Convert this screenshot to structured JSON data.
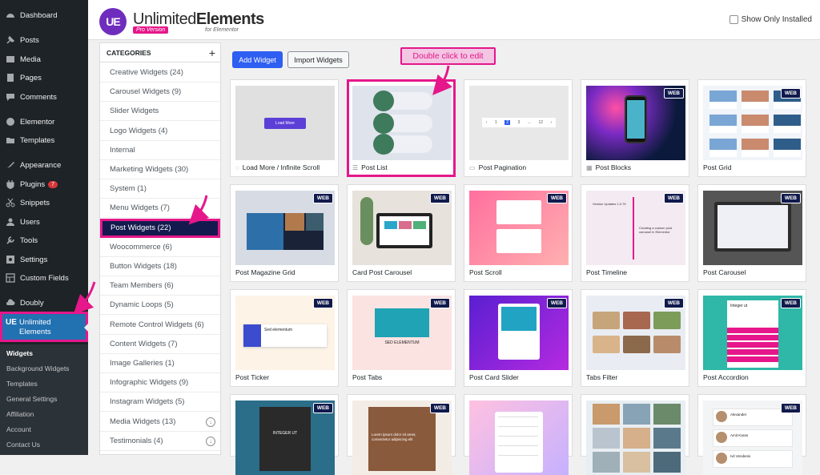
{
  "wp_menu": [
    {
      "label": "Dashboard",
      "icon": "dashboard-icon"
    },
    {
      "label": "Posts",
      "icon": "pin-icon"
    },
    {
      "label": "Media",
      "icon": "media-icon"
    },
    {
      "label": "Pages",
      "icon": "pages-icon"
    },
    {
      "label": "Comments",
      "icon": "comment-icon"
    },
    {
      "label": "Elementor",
      "icon": "elementor-icon"
    },
    {
      "label": "Templates",
      "icon": "folder-icon"
    },
    {
      "label": "Appearance",
      "icon": "brush-icon"
    },
    {
      "label": "Plugins",
      "icon": "plug-icon",
      "badge": "7"
    },
    {
      "label": "Snippets",
      "icon": "scissors-icon"
    },
    {
      "label": "Users",
      "icon": "user-icon"
    },
    {
      "label": "Tools",
      "icon": "wrench-icon"
    },
    {
      "label": "Settings",
      "icon": "settings-icon"
    },
    {
      "label": "Custom Fields",
      "icon": "fields-icon"
    },
    {
      "label": "Doubly",
      "icon": "cloud-icon"
    }
  ],
  "ue_menu_item": {
    "label_line1": "Unlimited",
    "label_line2": "Elements",
    "icon_text": "UE"
  },
  "submenu": [
    "Widgets",
    "Background Widgets",
    "Templates",
    "General Settings",
    "Affiliation",
    "Account",
    "Contact Us"
  ],
  "header": {
    "logo_initials": "UE",
    "logo_title_light": "Unlimited",
    "logo_title_bold": "Elements",
    "logo_badge": "Pro Version",
    "logo_sub": "for Elementor",
    "show_only_installed": "Show Only Installed"
  },
  "categories": {
    "title": "CATEGORIES",
    "add_symbol": "+",
    "items": [
      "Creative Widgets (24)",
      "Carousel Widgets (9)",
      "Slider Widgets",
      "Logo Widgets (4)",
      "Internal",
      "Marketing Widgets (30)",
      "System (1)",
      "Menu Widgets (7)",
      "Post Widgets (22)",
      "Woocommerce (6)",
      "Button Widgets (18)",
      "Team Members (6)",
      "Dynamic Loops (5)",
      "Remote Control Widgets (6)",
      "Content Widgets (7)",
      "Image Galleries (1)",
      "Infographic Widgets (9)",
      "Instagram Widgets (5)",
      "Media Widgets (13)",
      "Testimonials (4)"
    ],
    "selected": "Post Widgets (22)"
  },
  "toolbar": {
    "add_widget": "Add Widget",
    "import_widgets": "Import Widgets"
  },
  "callout": "Double click to edit",
  "web_badge": "WEB",
  "widgets": [
    "Load More / Infinite Scroll",
    "Post List",
    "Post Pagination",
    "Post Blocks",
    "Post Grid",
    "Post Magazine Grid",
    "Card Post Carousel",
    "Post Scroll",
    "Post Timeline",
    "Post Carousel",
    "Post Ticker",
    "Post Tabs",
    "Post Card Slider",
    "Tabs Filter",
    "Post Accordion",
    "",
    "",
    "",
    "",
    ""
  ],
  "thumb_text": {
    "load_more": "Load More",
    "pagination_pages": [
      "1",
      "2",
      "3",
      "...",
      "12"
    ],
    "timeline_date": "Version Updates 1.0.76",
    "timeline_title": "Creating a custom post carousel in Elementor",
    "ticker_title": "Sed elementum",
    "tabs_title": "SED ELEMENTUM",
    "accordion_title": "Integer ut",
    "magazine_title": "INTEGER UT",
    "lorem_title": "Lorem ipsum dolor sit amet, consectetur adipiscing elit",
    "people": [
      "Alexander",
      "Amit Karan",
      "Ivil Vendenis"
    ]
  }
}
